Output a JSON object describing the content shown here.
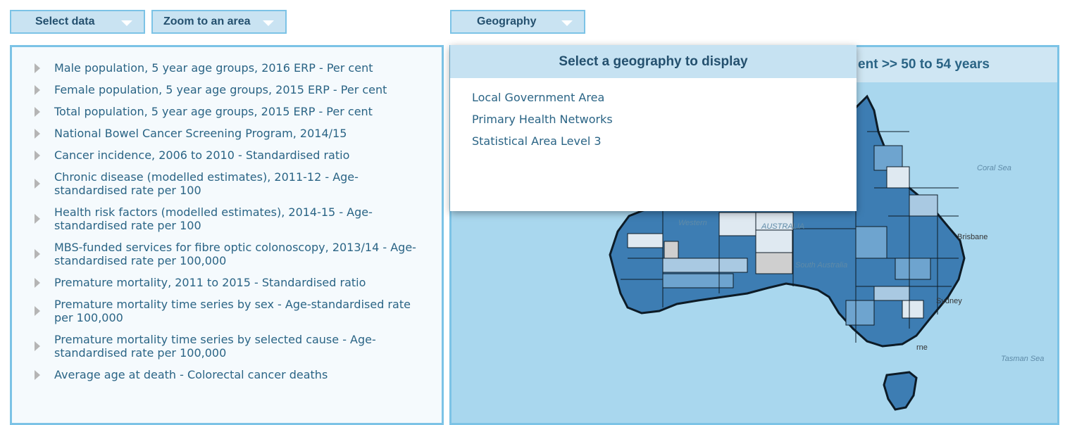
{
  "toolbar": {
    "select_data_label": "Select data",
    "zoom_label": "Zoom to an area",
    "geography_label": "Geography"
  },
  "data_list": {
    "items": [
      "Male population, 5 year age groups, 2016 ERP - Per cent",
      "Female population, 5 year age groups, 2015 ERP - Per cent",
      "Total population, 5 year age groups, 2015 ERP - Per cent",
      "National Bowel Cancer Screening Program, 2014/15",
      "Cancer incidence, 2006 to 2010 - Standardised ratio",
      "Chronic disease (modelled estimates), 2011-12 - Age-standardised rate per 100",
      "Health risk factors (modelled estimates), 2014-15 - Age-standardised rate per 100",
      "MBS-funded services for fibre optic colonoscopy, 2013/14 - Age-standardised rate per 100,000",
      "Premature mortality, 2011 to 2015 - Standardised ratio",
      "Premature mortality time series by sex - Age-standardised rate per 100,000",
      "Premature mortality time series by selected cause - Age-standardised rate per 100,000",
      "Average age at death - Colorectal cancer deaths"
    ]
  },
  "map": {
    "title_visible": "ent >>  50 to 54 years",
    "labels": {
      "coral_sea": "Coral Sea",
      "tasman_sea": "Tasman Sea",
      "brisbane": "Brisbane",
      "sydney": "Sydney",
      "australia": "AUSTRALIA",
      "south_australia": "South Australia",
      "western": "Western",
      "melbourne": "rne"
    },
    "colors": {
      "ocean": "#a9d7ee",
      "dark_region": "#3d7db3",
      "mid_region": "#6ea4cf",
      "light_region": "#a9c9e2",
      "pale_region": "#dfe9f1",
      "grey_region": "#cfcfcf"
    }
  },
  "geography_popup": {
    "title": "Select a geography to display",
    "options": [
      "Local Government Area",
      "Primary Health Networks",
      "Statistical Area Level 3"
    ]
  }
}
